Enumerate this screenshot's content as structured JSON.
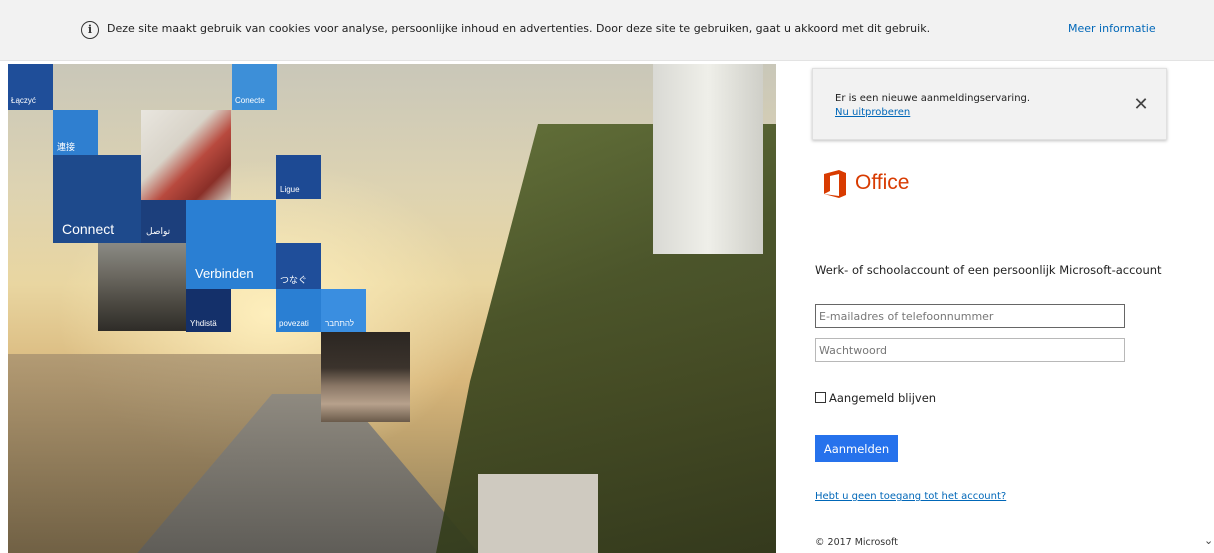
{
  "cookie_banner": {
    "icon": "info-icon",
    "text": "Deze site maakt gebruik van cookies voor analyse, persoonlijke inhoud en advertenties. Door deze site te gebruiken, gaat u akkoord met dit gebruik.",
    "link": "Meer informatie"
  },
  "hero": {
    "tiles": [
      {
        "label": "Łączyć",
        "color": "#1f4e99"
      },
      {
        "label": "Conecte",
        "color": "#3d8fd8"
      },
      {
        "label": "連接",
        "color": "#2f7fd0"
      },
      {
        "label": "Connect",
        "color": "#1e4a8c"
      },
      {
        "label": "تواصل",
        "color": "#1c3f7c"
      },
      {
        "label": "Ligue",
        "color": "#1d4a94"
      },
      {
        "label": "Verbinden",
        "color": "#2a7fd3"
      },
      {
        "label": "つなぐ",
        "color": "#1f4e9a"
      },
      {
        "label": "Yhdistä",
        "color": "#14306a"
      },
      {
        "label": "povezati",
        "color": "#2a7fd3"
      },
      {
        "label": "להתחבר",
        "color": "#3a8ee0"
      }
    ]
  },
  "notification": {
    "text": "Er is een nieuwe aanmeldingservaring.",
    "link": "Nu uitproberen",
    "close_icon": "close-icon"
  },
  "brand": {
    "logo_icon": "office-logo-icon",
    "name": "Office",
    "color": "#d83b01"
  },
  "login": {
    "subtitle": "Werk- of schoolaccount of een persoonlijk Microsoft-account",
    "email_placeholder": "E-mailadres of telefoonnummer",
    "password_placeholder": "Wachtwoord",
    "remember_label": "Aangemeld blijven",
    "signin_label": "Aanmelden",
    "no_access_link": "Hebt u geen toegang tot het account?",
    "accent": "#2672ec"
  },
  "footer": {
    "copyright": "© 2017 Microsoft"
  }
}
